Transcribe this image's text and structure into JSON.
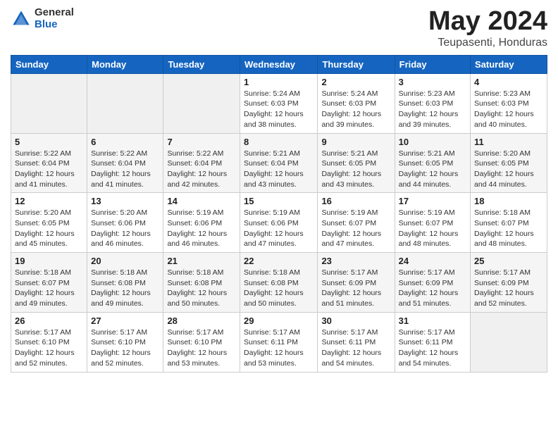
{
  "logo": {
    "general": "General",
    "blue": "Blue"
  },
  "title": {
    "month_year": "May 2024",
    "location": "Teupasenti, Honduras"
  },
  "weekdays": [
    "Sunday",
    "Monday",
    "Tuesday",
    "Wednesday",
    "Thursday",
    "Friday",
    "Saturday"
  ],
  "weeks": [
    [
      {
        "day": "",
        "info": ""
      },
      {
        "day": "",
        "info": ""
      },
      {
        "day": "",
        "info": ""
      },
      {
        "day": "1",
        "info": "Sunrise: 5:24 AM\nSunset: 6:03 PM\nDaylight: 12 hours\nand 38 minutes."
      },
      {
        "day": "2",
        "info": "Sunrise: 5:24 AM\nSunset: 6:03 PM\nDaylight: 12 hours\nand 39 minutes."
      },
      {
        "day": "3",
        "info": "Sunrise: 5:23 AM\nSunset: 6:03 PM\nDaylight: 12 hours\nand 39 minutes."
      },
      {
        "day": "4",
        "info": "Sunrise: 5:23 AM\nSunset: 6:03 PM\nDaylight: 12 hours\nand 40 minutes."
      }
    ],
    [
      {
        "day": "5",
        "info": "Sunrise: 5:22 AM\nSunset: 6:04 PM\nDaylight: 12 hours\nand 41 minutes."
      },
      {
        "day": "6",
        "info": "Sunrise: 5:22 AM\nSunset: 6:04 PM\nDaylight: 12 hours\nand 41 minutes."
      },
      {
        "day": "7",
        "info": "Sunrise: 5:22 AM\nSunset: 6:04 PM\nDaylight: 12 hours\nand 42 minutes."
      },
      {
        "day": "8",
        "info": "Sunrise: 5:21 AM\nSunset: 6:04 PM\nDaylight: 12 hours\nand 43 minutes."
      },
      {
        "day": "9",
        "info": "Sunrise: 5:21 AM\nSunset: 6:05 PM\nDaylight: 12 hours\nand 43 minutes."
      },
      {
        "day": "10",
        "info": "Sunrise: 5:21 AM\nSunset: 6:05 PM\nDaylight: 12 hours\nand 44 minutes."
      },
      {
        "day": "11",
        "info": "Sunrise: 5:20 AM\nSunset: 6:05 PM\nDaylight: 12 hours\nand 44 minutes."
      }
    ],
    [
      {
        "day": "12",
        "info": "Sunrise: 5:20 AM\nSunset: 6:05 PM\nDaylight: 12 hours\nand 45 minutes."
      },
      {
        "day": "13",
        "info": "Sunrise: 5:20 AM\nSunset: 6:06 PM\nDaylight: 12 hours\nand 46 minutes."
      },
      {
        "day": "14",
        "info": "Sunrise: 5:19 AM\nSunset: 6:06 PM\nDaylight: 12 hours\nand 46 minutes."
      },
      {
        "day": "15",
        "info": "Sunrise: 5:19 AM\nSunset: 6:06 PM\nDaylight: 12 hours\nand 47 minutes."
      },
      {
        "day": "16",
        "info": "Sunrise: 5:19 AM\nSunset: 6:07 PM\nDaylight: 12 hours\nand 47 minutes."
      },
      {
        "day": "17",
        "info": "Sunrise: 5:19 AM\nSunset: 6:07 PM\nDaylight: 12 hours\nand 48 minutes."
      },
      {
        "day": "18",
        "info": "Sunrise: 5:18 AM\nSunset: 6:07 PM\nDaylight: 12 hours\nand 48 minutes."
      }
    ],
    [
      {
        "day": "19",
        "info": "Sunrise: 5:18 AM\nSunset: 6:07 PM\nDaylight: 12 hours\nand 49 minutes."
      },
      {
        "day": "20",
        "info": "Sunrise: 5:18 AM\nSunset: 6:08 PM\nDaylight: 12 hours\nand 49 minutes."
      },
      {
        "day": "21",
        "info": "Sunrise: 5:18 AM\nSunset: 6:08 PM\nDaylight: 12 hours\nand 50 minutes."
      },
      {
        "day": "22",
        "info": "Sunrise: 5:18 AM\nSunset: 6:08 PM\nDaylight: 12 hours\nand 50 minutes."
      },
      {
        "day": "23",
        "info": "Sunrise: 5:17 AM\nSunset: 6:09 PM\nDaylight: 12 hours\nand 51 minutes."
      },
      {
        "day": "24",
        "info": "Sunrise: 5:17 AM\nSunset: 6:09 PM\nDaylight: 12 hours\nand 51 minutes."
      },
      {
        "day": "25",
        "info": "Sunrise: 5:17 AM\nSunset: 6:09 PM\nDaylight: 12 hours\nand 52 minutes."
      }
    ],
    [
      {
        "day": "26",
        "info": "Sunrise: 5:17 AM\nSunset: 6:10 PM\nDaylight: 12 hours\nand 52 minutes."
      },
      {
        "day": "27",
        "info": "Sunrise: 5:17 AM\nSunset: 6:10 PM\nDaylight: 12 hours\nand 52 minutes."
      },
      {
        "day": "28",
        "info": "Sunrise: 5:17 AM\nSunset: 6:10 PM\nDaylight: 12 hours\nand 53 minutes."
      },
      {
        "day": "29",
        "info": "Sunrise: 5:17 AM\nSunset: 6:11 PM\nDaylight: 12 hours\nand 53 minutes."
      },
      {
        "day": "30",
        "info": "Sunrise: 5:17 AM\nSunset: 6:11 PM\nDaylight: 12 hours\nand 54 minutes."
      },
      {
        "day": "31",
        "info": "Sunrise: 5:17 AM\nSunset: 6:11 PM\nDaylight: 12 hours\nand 54 minutes."
      },
      {
        "day": "",
        "info": ""
      }
    ]
  ]
}
